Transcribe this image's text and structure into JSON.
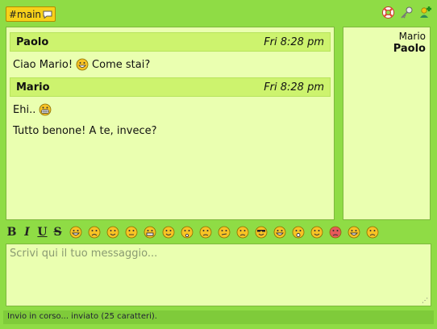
{
  "channel": {
    "name": "#main"
  },
  "topbar_icons": [
    "lifebuoy-icon",
    "key-icon",
    "add-user-icon"
  ],
  "messages": [
    {
      "author": "Paolo",
      "time": "Fri 8:28 pm",
      "lines": [
        {
          "before": "Ciao Mario!",
          "emoticon": "grin-emoticon",
          "after": "Come stai?"
        }
      ]
    },
    {
      "author": "Mario",
      "time": "Fri 8:28 pm",
      "lines": [
        {
          "before": "Ehi..",
          "emoticon": "big-smile-emoticon",
          "after": ""
        },
        {
          "before": "Tutto benone! A te, invece?",
          "emoticon": "",
          "after": ""
        }
      ]
    }
  ],
  "users": [
    "Mario",
    "Paolo"
  ],
  "format_buttons": [
    "B",
    "I",
    "U",
    "S"
  ],
  "smileys": [
    "laugh",
    "sad",
    "smile",
    "neutral",
    "grin",
    "tongue",
    "surprised",
    "worried",
    "confused",
    "angry",
    "cool",
    "laughing",
    "wow",
    "devil",
    "red-angry",
    "crying-laugh",
    "frown"
  ],
  "input": {
    "placeholder": "Scrivi qui il tuo messaggio..."
  },
  "status": {
    "text": "Invio in corso... inviato (25 caratteri)."
  },
  "colors": {
    "background": "#8fdc45",
    "panel": "#eaffb0",
    "header": "#cdf36e",
    "tab": "#f7d11a"
  }
}
